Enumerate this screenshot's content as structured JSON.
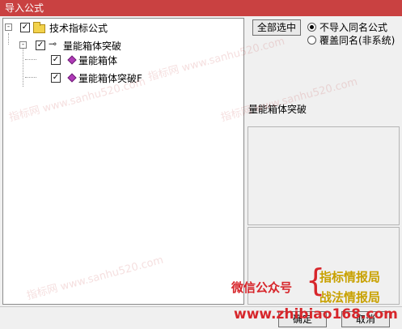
{
  "window": {
    "title": "导入公式"
  },
  "tree": {
    "root": {
      "label": "技术指标公式",
      "checked": true,
      "expander": "-"
    },
    "group": {
      "label": "量能箱体突破",
      "checked": true,
      "expander": "-"
    },
    "items": [
      {
        "label": "量能箱体",
        "checked": true
      },
      {
        "label": "量能箱体突破F",
        "checked": true
      }
    ]
  },
  "options": {
    "select_all_label": "全部选中",
    "radio_skip_label": "不导入同名公式",
    "radio_overwrite_label": "覆盖同名(非系统)",
    "selected": "skip"
  },
  "preview": {
    "title": "量能箱体突破"
  },
  "footer": {
    "ok_label": "确定",
    "cancel_label": "取消"
  },
  "overlay": {
    "watermark_text": "指标网 www.sanhu520.com",
    "wechat_label": "微信公众号",
    "brand1": "指标情报局",
    "brand2": "战法情报局",
    "url": "www.zhibiao168.com"
  }
}
